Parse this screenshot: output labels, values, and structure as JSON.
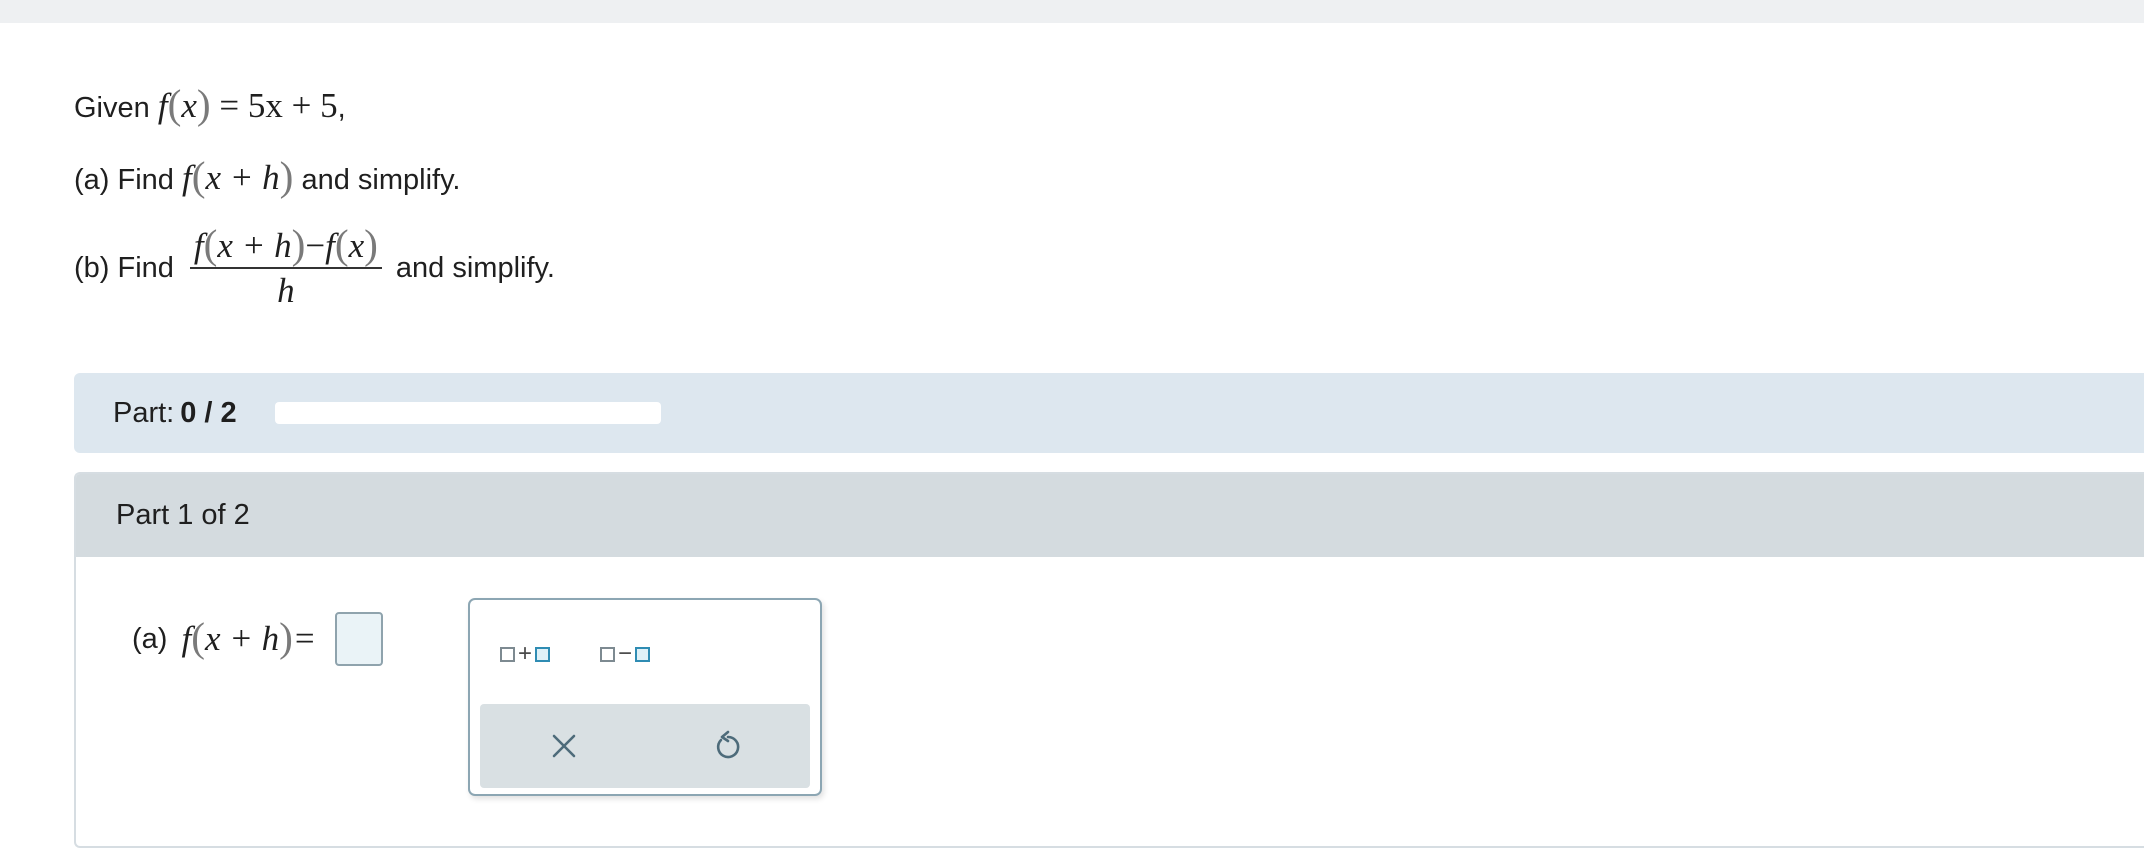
{
  "problem": {
    "given_label": "Given",
    "function_def": {
      "f": "f",
      "x": "x",
      "rhs": "5x + 5",
      "trail": ","
    },
    "part_a": {
      "prefix": "(a) Find",
      "f": "f",
      "arg": "x + h",
      "suffix": "and simplify."
    },
    "part_b": {
      "prefix": "(b) Find",
      "numerator": {
        "f1": "f",
        "arg1": "x + h",
        "minus": "−",
        "f2": "f",
        "arg2": "x"
      },
      "denominator": "h",
      "suffix": "and simplify."
    }
  },
  "progress": {
    "label": "Part:",
    "value_text": "0 / 2",
    "completed": 0,
    "total": 2
  },
  "part_card": {
    "header": "Part 1 of 2",
    "answer": {
      "label": "(a)",
      "f": "f",
      "arg": "x + h",
      "equals": "=",
      "value": ""
    },
    "palette": {
      "keys": [
        {
          "name": "box-plus-box",
          "op": "+"
        },
        {
          "name": "box-minus-box",
          "op": "−"
        }
      ],
      "actions": [
        {
          "name": "clear",
          "icon": "close-icon"
        },
        {
          "name": "undo",
          "icon": "undo-icon"
        }
      ]
    }
  },
  "colors": {
    "progress_bg": "#dde7ef",
    "header_bg": "#d4dbdf",
    "accent": "#2f8cb3",
    "icon": "#4d6b7a"
  }
}
